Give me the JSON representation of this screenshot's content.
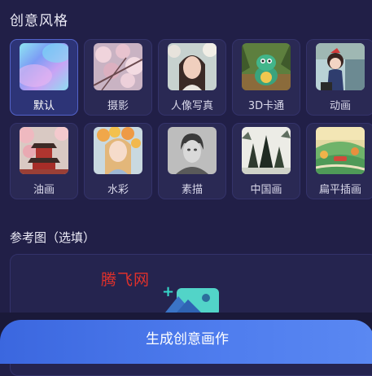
{
  "sections": {
    "style_title": "创意风格",
    "reference_title": "参考图（选填）"
  },
  "styles": [
    {
      "label": "默认",
      "selected": true,
      "icon": "gradient-thumbnail"
    },
    {
      "label": "摄影",
      "selected": false,
      "icon": "cherry-blossom-photo"
    },
    {
      "label": "人像写真",
      "selected": false,
      "icon": "portrait-photo"
    },
    {
      "label": "3D卡通",
      "selected": false,
      "icon": "3d-dinosaur"
    },
    {
      "label": "动画",
      "selected": false,
      "icon": "anime-girl"
    },
    {
      "label": "油画",
      "selected": false,
      "icon": "oil-painting-temple"
    },
    {
      "label": "水彩",
      "selected": false,
      "icon": "watercolor-girl"
    },
    {
      "label": "素描",
      "selected": false,
      "icon": "sketch-portrait"
    },
    {
      "label": "中国画",
      "selected": false,
      "icon": "chinese-ink-painting"
    },
    {
      "label": "扁平插画",
      "selected": false,
      "icon": "flat-illustration"
    }
  ],
  "reference": {
    "watermark": "腾飞网",
    "upload_icon": "add-image-icon"
  },
  "generate_button": "生成创意画作",
  "colors": {
    "background": "#211f47",
    "accent": "#4f7dee",
    "selected_border": "#5363c9"
  }
}
